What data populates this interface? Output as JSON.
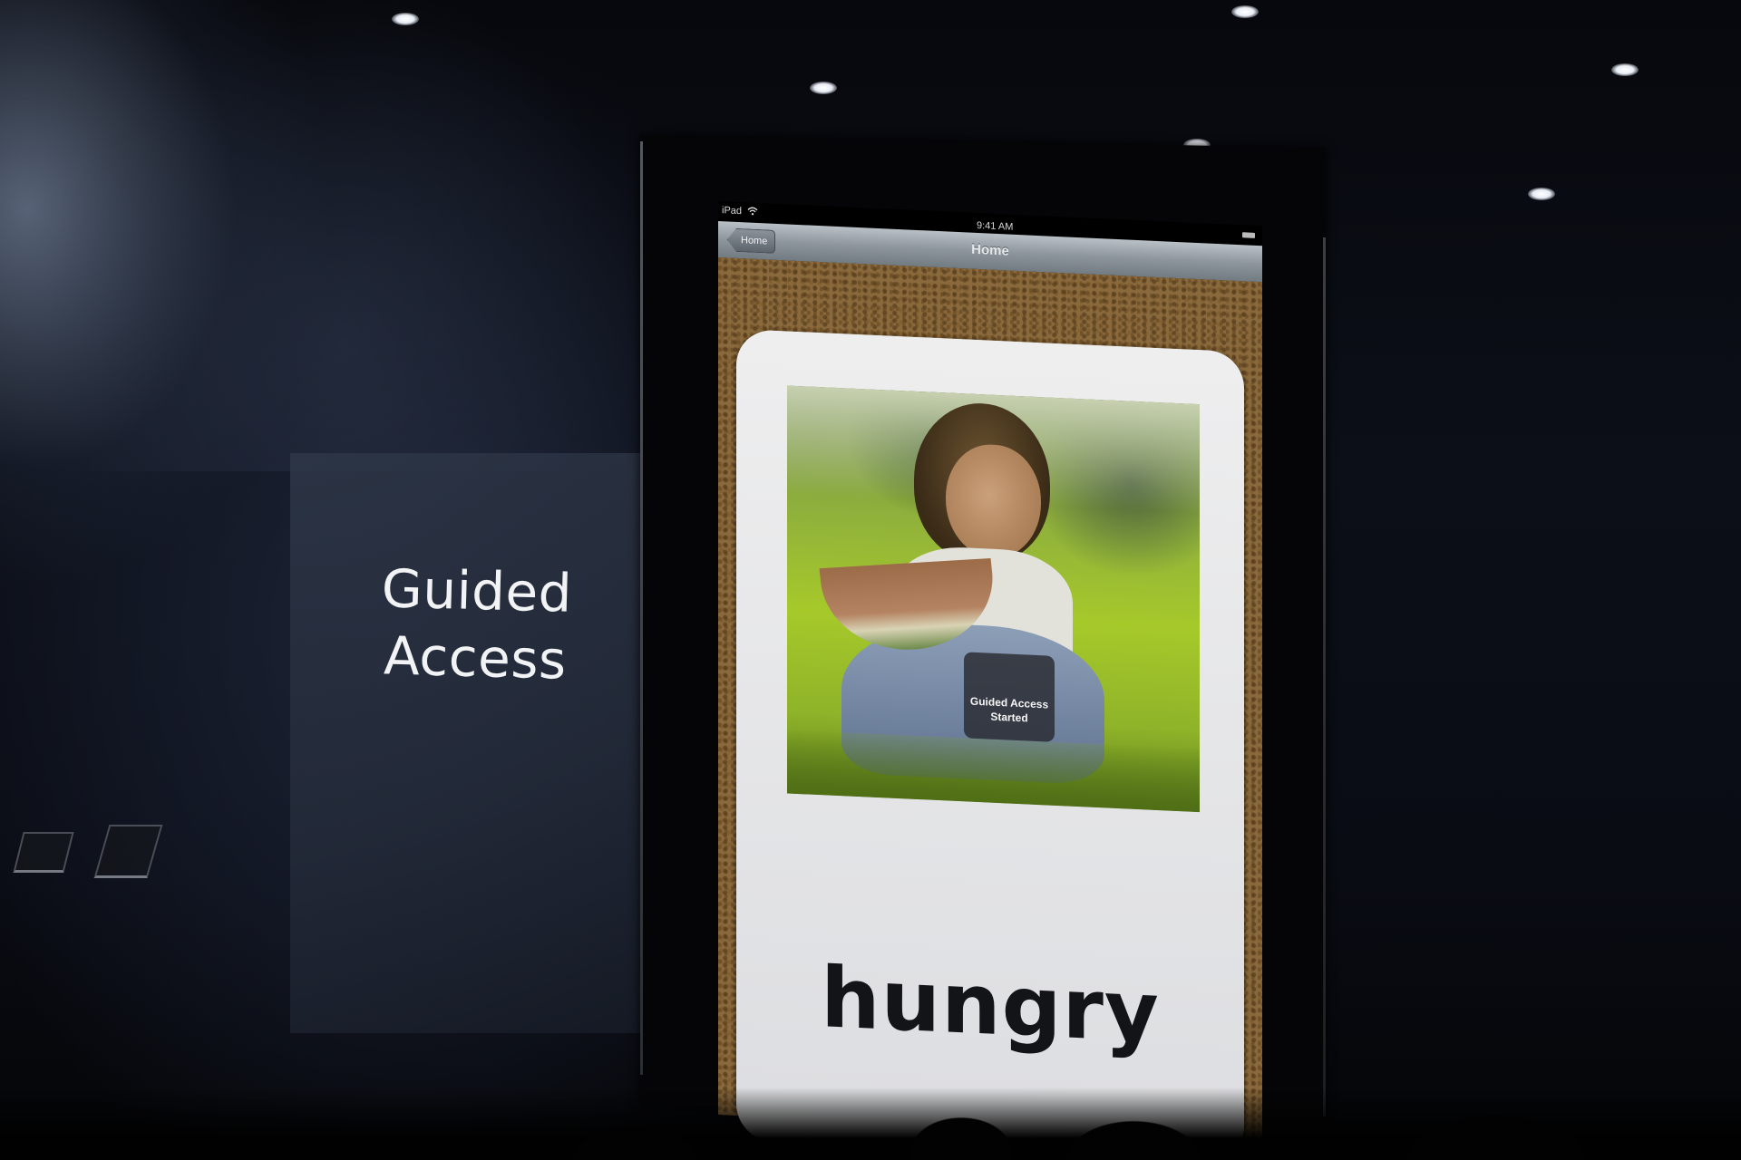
{
  "slide": {
    "title_line1": "Guided",
    "title_line2": "Access"
  },
  "ipad": {
    "status_bar": {
      "carrier": "iPad",
      "time": "9:41 AM"
    },
    "nav_bar": {
      "back_label": "Home",
      "title": "Home"
    },
    "card": {
      "word": "hungry"
    },
    "toast": {
      "line1": "Guided Access",
      "line2": "Started"
    }
  },
  "icons": [
    "wifi-icon",
    "battery-icon",
    "back-arrow-icon"
  ]
}
